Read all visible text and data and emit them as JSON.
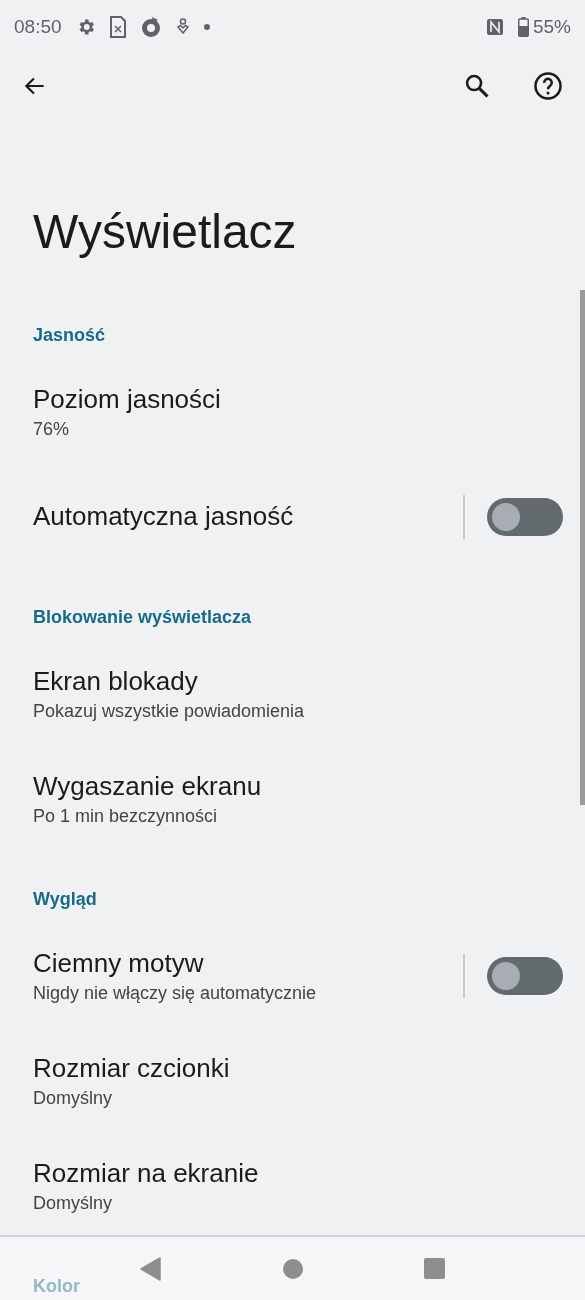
{
  "status_bar": {
    "time": "08:50",
    "battery": "55%"
  },
  "title": "Wyświetlacz",
  "sections": [
    {
      "header": "Jasność",
      "items": [
        {
          "kind": "text",
          "title": "Poziom jasności",
          "summary": "76%"
        },
        {
          "kind": "toggle",
          "title": "Automatyczna jasność",
          "on": false
        }
      ]
    },
    {
      "header": "Blokowanie wyświetlacza",
      "items": [
        {
          "kind": "text",
          "title": "Ekran blokady",
          "summary": "Pokazuj wszystkie powiadomienia"
        },
        {
          "kind": "text",
          "title": "Wygaszanie ekranu",
          "summary": "Po 1 min bezczynności"
        }
      ]
    },
    {
      "header": "Wygląd",
      "items": [
        {
          "kind": "toggle",
          "title": "Ciemny motyw",
          "summary": "Nigdy nie włączy się automatycznie",
          "on": false
        },
        {
          "kind": "text",
          "title": "Rozmiar czcionki",
          "summary": "Domyślny"
        },
        {
          "kind": "text",
          "title": "Rozmiar na ekranie",
          "summary": "Domyślny"
        }
      ]
    },
    {
      "header": "Kolor"
    }
  ]
}
